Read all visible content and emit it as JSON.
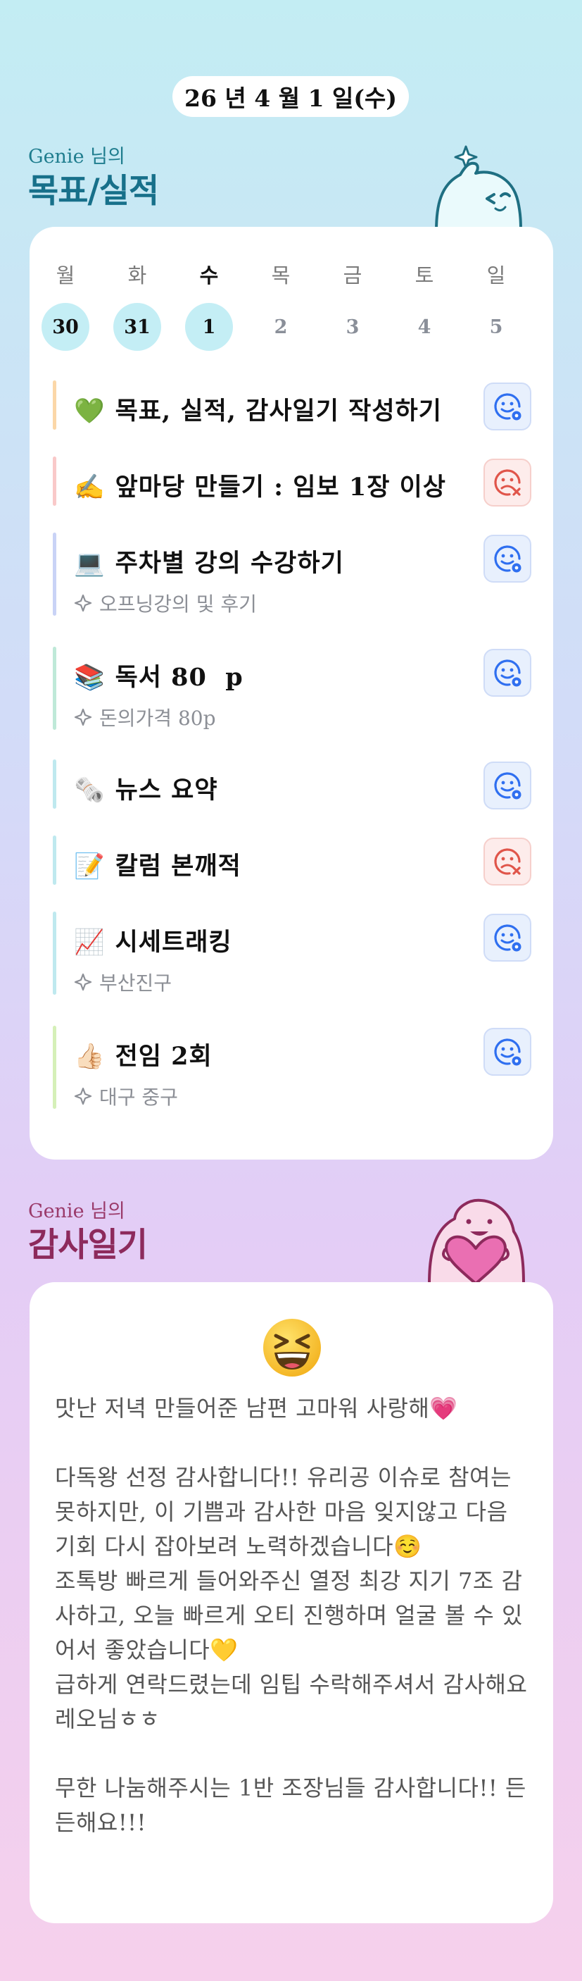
{
  "header": {
    "date": "26 년 4 월 1 일(수)"
  },
  "goals_section": {
    "owner": "Genie 님의",
    "title": "목표/실적"
  },
  "week": {
    "days": [
      "월",
      "화",
      "수",
      "목",
      "금",
      "토",
      "일"
    ],
    "dates": [
      "30",
      "31",
      "1",
      "2",
      "3",
      "4",
      "5"
    ],
    "today_index": 2
  },
  "goals": [
    {
      "emoji": "💚",
      "title": "목표, 실적, 감사일기 작성하기",
      "subtitle": "",
      "status": "done",
      "bar_color": "#fbd7a8"
    },
    {
      "emoji": "✍️",
      "title": "앞마당 만들기 : 임보 1장 이상",
      "subtitle": "",
      "status": "failed",
      "bar_color": "#f9c9c9"
    },
    {
      "emoji": "💻",
      "title": "주차별 강의 수강하기",
      "subtitle": "오프닝강의 및 후기",
      "status": "done",
      "bar_color": "#c9d3f6"
    },
    {
      "emoji": "📚",
      "title": "독서 80  p",
      "subtitle": "돈의가격 80p",
      "status": "done",
      "bar_color": "#bfe9d8"
    },
    {
      "emoji": "🗞️",
      "title": "뉴스 요약",
      "subtitle": "",
      "status": "done",
      "bar_color": "#bfe9ef"
    },
    {
      "emoji": "📝",
      "title": "칼럼 본깨적",
      "subtitle": "",
      "status": "failed",
      "bar_color": "#bfe9ef"
    },
    {
      "emoji": "📈",
      "title": "시세트래킹",
      "subtitle": "부산진구",
      "status": "done",
      "bar_color": "#bfe9ef"
    },
    {
      "emoji": "👍🏻",
      "title": "전임 2회",
      "subtitle": "대구 중구",
      "status": "done",
      "bar_color": "#d5f0b8"
    }
  ],
  "diary_section": {
    "owner": "Genie 님의",
    "title": "감사일기"
  },
  "diary": {
    "mood_icon": "grinning-squinting-face-icon",
    "text": "맛난 저녁 만들어준 남편 고마워 사랑해💗\n\n다독왕 선정 감사합니다!! 유리공 이슈로 참여는 못하지만, 이 기쁨과 감사한 마음 잊지않고 다음 기회 다시 잡아보려 노력하겠습니다☺️\n조톡방 빠르게 들어와주신 열정 최강 지기 7조 감사하고, 오늘 빠르게 오티 진행하며 얼굴 볼 수 있어서 좋았습니다💛\n급하게 연락드렸는데 임팁 수락해주셔서 감사해요 레오님ㅎㅎ\n\n무한 나눔해주시는 1반 조장님들 감사합니다!! 든든해요!!!"
  },
  "colors": {
    "goals_title": "#17708a",
    "goals_owner": "#1f7d8e",
    "diary_title": "#8d2a5c",
    "diary_owner": "#9a3a6a",
    "status_done": "#2f6ff0",
    "status_failed": "#e0554a"
  }
}
